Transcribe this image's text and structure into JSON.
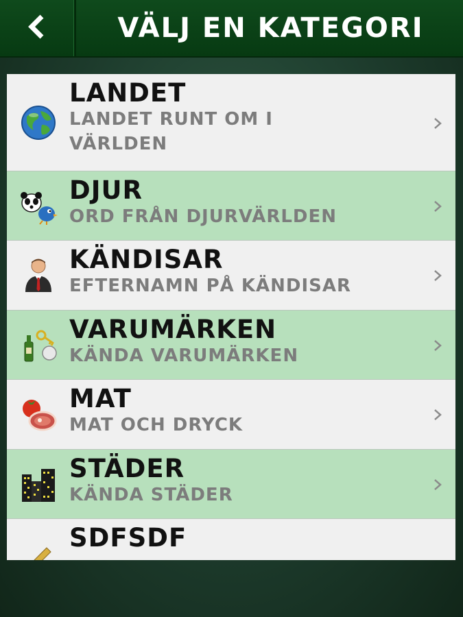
{
  "header": {
    "back_icon": "chevron-left-icon",
    "title": "VÄLJ EN KATEGORI"
  },
  "categories": [
    {
      "name": "LANDET",
      "subtitle": "LANDET RUNT OM I VÄRLDEN",
      "icon": "globe-icon"
    },
    {
      "name": "DJUR",
      "subtitle": "ORD FRÅN DJURVÄRLDEN",
      "icon": "animals-icon"
    },
    {
      "name": "KÄNDISAR",
      "subtitle": "EFTERNAMN PÅ KÄNDISAR",
      "icon": "person-icon"
    },
    {
      "name": "VARUMÄRKEN",
      "subtitle": "KÄNDA VARUMÄRKEN",
      "icon": "brands-icon"
    },
    {
      "name": "MAT",
      "subtitle": "MAT OCH DRYCK",
      "icon": "food-icon"
    },
    {
      "name": "STÄDER",
      "subtitle": "KÄNDA STÄDER",
      "icon": "city-icon"
    },
    {
      "name": "SDFSDF",
      "subtitle": "",
      "icon": "pencil-icon"
    }
  ],
  "colors": {
    "header": "#0b4417",
    "row_light": "#f0f0f0",
    "row_green": "#b7e0bc",
    "subtitle": "#7c7c7c"
  }
}
